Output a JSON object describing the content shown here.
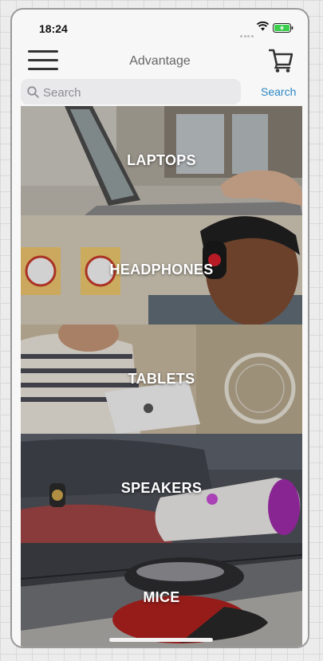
{
  "status_bar": {
    "time": "18:24"
  },
  "header": {
    "title": "Advantage",
    "menu_icon": "hamburger-menu-icon",
    "cart_icon": "cart-icon"
  },
  "search": {
    "placeholder": "Search",
    "button_label": "Search"
  },
  "categories": [
    {
      "label": "LAPTOPS"
    },
    {
      "label": "HEADPHONES"
    },
    {
      "label": "TABLETS"
    },
    {
      "label": "SPEAKERS"
    },
    {
      "label": "MICE"
    }
  ],
  "colors": {
    "accent": "#2b86c5",
    "speaker_accent": "#9c2ba8",
    "mouse_red": "#a8201e"
  }
}
